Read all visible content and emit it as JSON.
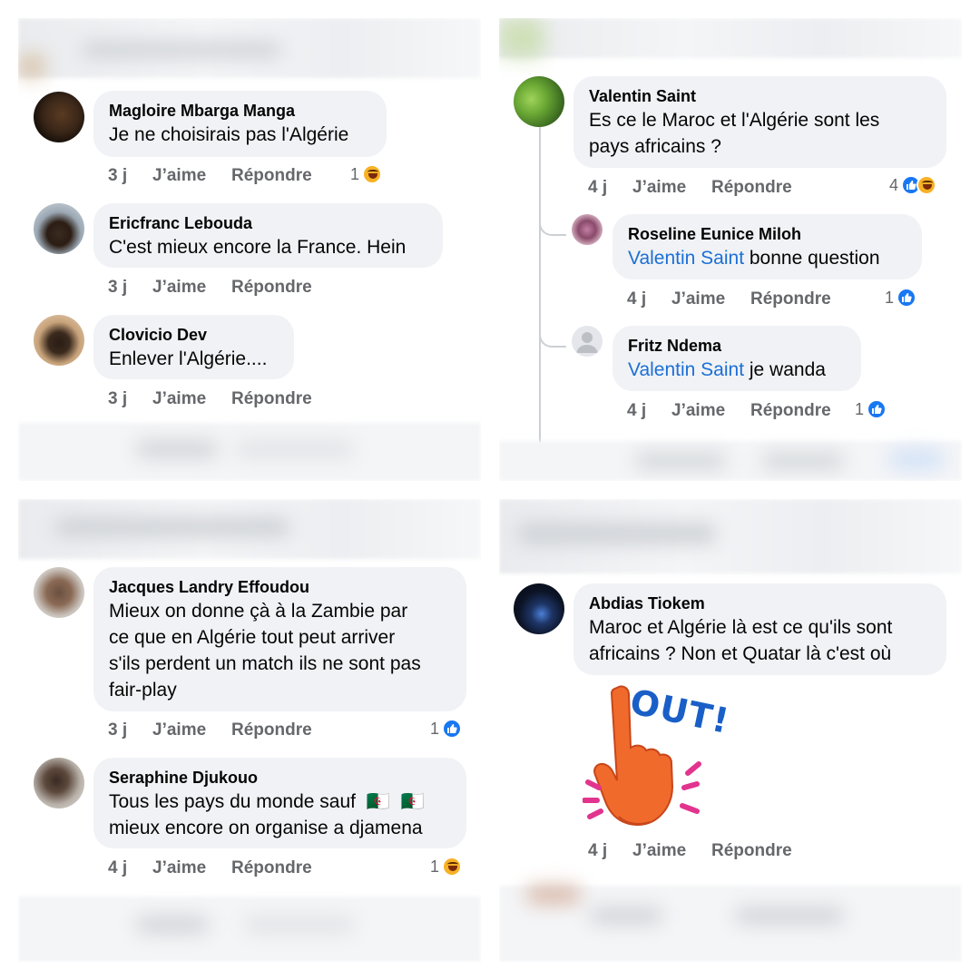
{
  "actions": {
    "like": "J’aime",
    "reply": "Répondre"
  },
  "panels": {
    "top_left": {
      "comments": [
        {
          "author": "Magloire Mbarga Manga",
          "text": "Je ne choisirais pas l'Algérie",
          "time": "3 j",
          "reaction_count": "1",
          "reactions": [
            "haha-icon"
          ]
        },
        {
          "author": "Ericfranc Lebouda",
          "text": "C'est mieux encore la France. Hein",
          "time": "3 j"
        },
        {
          "author": "Clovicio Dev",
          "text": "Enlever l'Algérie....",
          "time": "3 j"
        }
      ]
    },
    "top_right": {
      "comments": [
        {
          "author": "Valentin Saint",
          "text_lines": [
            "Es ce le Maroc et l'Algérie sont les",
            "pays africains ?"
          ],
          "time": "4 j",
          "reaction_count": "4",
          "reactions": [
            "like-icon",
            "haha-icon"
          ]
        }
      ],
      "replies": [
        {
          "author": "Roseline Eunice Miloh",
          "mention": "Valentin Saint",
          "text": " bonne question",
          "time": "4 j",
          "reaction_count": "1",
          "reactions": [
            "like-icon"
          ]
        },
        {
          "author": "Fritz Ndema",
          "mention": "Valentin Saint",
          "text": " je wanda",
          "time": "4 j",
          "reaction_count": "1",
          "reactions": [
            "like-icon"
          ]
        }
      ]
    },
    "bottom_left": {
      "comments": [
        {
          "author": "Jacques Landry Effoudou",
          "text_lines": [
            "Mieux on donne çà à la Zambie par",
            "ce que en Algérie tout peut arriver",
            "s'ils perdent un match ils ne sont pas",
            "fair-play"
          ],
          "time": "3 j",
          "reaction_count": "1",
          "reactions": [
            "like-icon"
          ]
        },
        {
          "author": "Seraphine Djukouo",
          "text_lines": [
            "Tous les pays du monde sauf",
            "mieux encore on organise a djamena"
          ],
          "flags": [
            "🇩🇿",
            "🇩🇿"
          ],
          "time": "4 j",
          "reaction_count": "1",
          "reactions": [
            "haha-icon"
          ]
        }
      ]
    },
    "bottom_right": {
      "comments": [
        {
          "author": "Abdias Tiokem",
          "text_lines": [
            "Maroc et Algérie là est ce qu'ils sont",
            "africains ? Non et Quatar là c'est où"
          ],
          "time": "4 j",
          "sticker_text": "OUT!"
        }
      ]
    }
  },
  "colors": {
    "bubble": "#f0f2f5",
    "meta": "#65676b",
    "link": "#1c6fd6",
    "like": "#1877f2",
    "haha": "#f7b125",
    "sticker_hand": "#f06a2c",
    "sticker_text": "#1a5fc7",
    "sticker_splash": "#e2348e"
  }
}
